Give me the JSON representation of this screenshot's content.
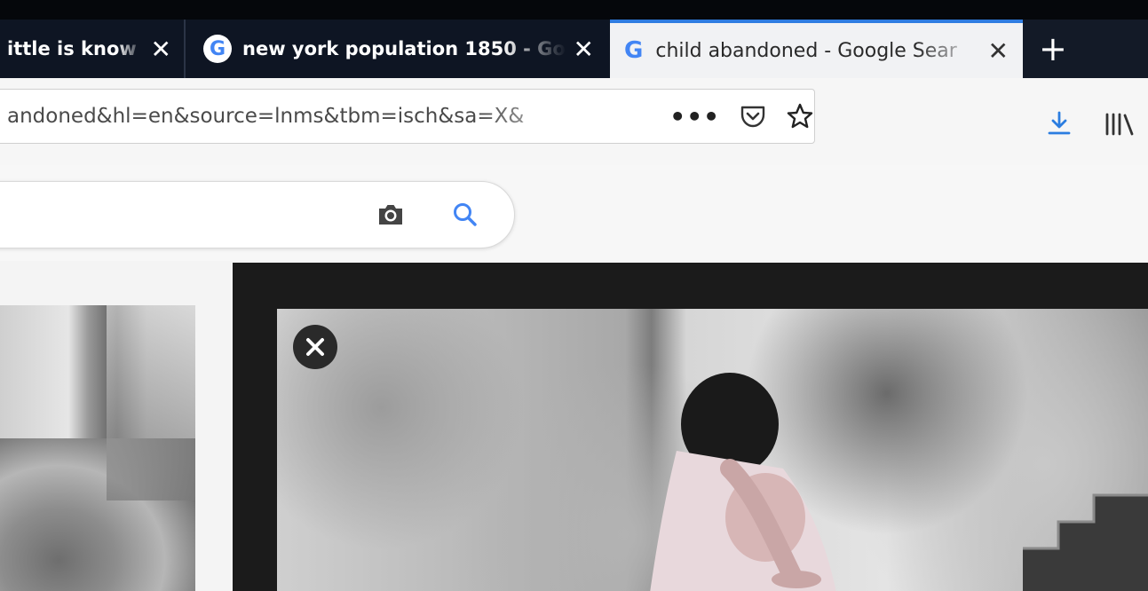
{
  "browser": {
    "tabs": [
      {
        "title": "ittle is know",
        "icon": "none",
        "active": false
      },
      {
        "title": "new york population 1850 - Go",
        "icon": "google-g-icon",
        "active": false
      },
      {
        "title": "child abandoned - Google Sear",
        "icon": "google-g-icon",
        "active": true
      }
    ],
    "tab_close_glyph": "✕",
    "new_tab_glyph": "+",
    "url": "andoned&hl=en&source=lnms&tbm=isch&sa=X&",
    "page_actions_glyph": "•••",
    "icons": [
      "pocket-icon",
      "bookmark-star-icon",
      "download-icon",
      "library-icon"
    ],
    "colors": {
      "tabstrip": "#0d1420",
      "active_tab_accent": "#2f7de1",
      "download_blue": "#2b7de0"
    }
  },
  "google": {
    "search_value": "",
    "icons": [
      "camera-icon",
      "search-icon"
    ],
    "accent": "#4285f4"
  },
  "results": {
    "preview_close_glyph": "✕"
  }
}
